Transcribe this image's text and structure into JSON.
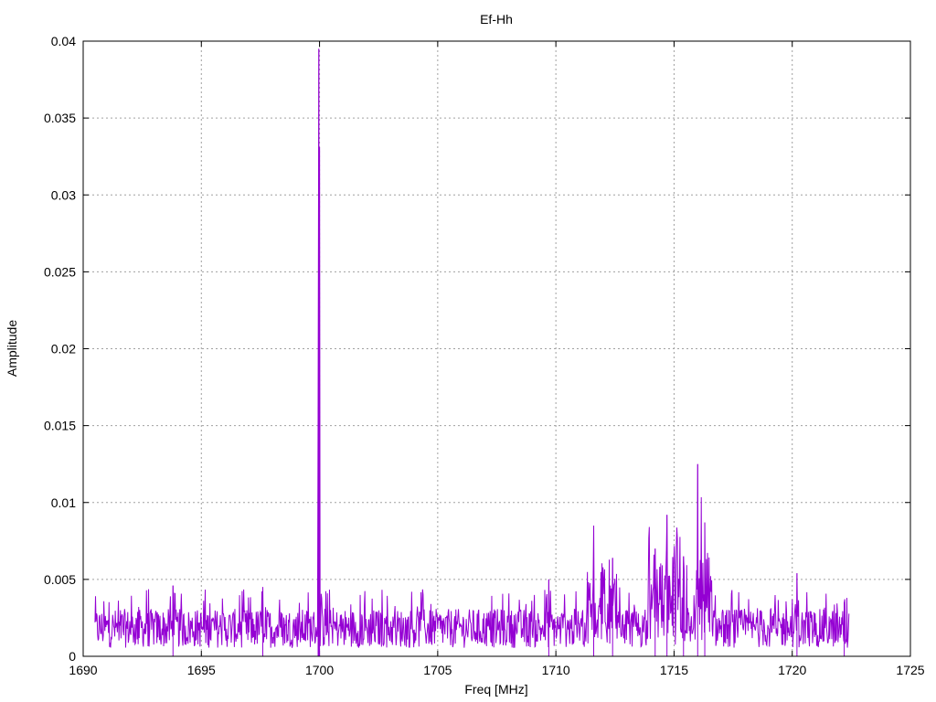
{
  "chart_data": {
    "type": "line",
    "title": "Ef-Hh",
    "xlabel": "Freq [MHz]",
    "ylabel": "Amplitude",
    "xlim": [
      1690,
      1725
    ],
    "ylim": [
      0,
      0.04
    ],
    "xticks": [
      1690,
      1695,
      1700,
      1705,
      1710,
      1715,
      1720,
      1725
    ],
    "yticks": [
      0,
      0.005,
      0.01,
      0.015,
      0.02,
      0.025,
      0.03,
      0.035,
      0.04
    ],
    "ytick_labels": [
      "0",
      "0.005",
      "0.01",
      "0.015",
      "0.02",
      "0.025",
      "0.03",
      "0.035",
      "0.04"
    ],
    "grid": true,
    "legend": "none",
    "series": [
      {
        "color": "#9400d3",
        "x_range": [
          1690.5,
          1722.4
        ],
        "peaks": [
          {
            "x": 1693.8,
            "y": 0.0046
          },
          {
            "x": 1697.6,
            "y": 0.0045
          },
          {
            "x": 1699.97,
            "y": 0.0395
          },
          {
            "x": 1700.0,
            "y": 0.0331
          },
          {
            "x": 1699.94,
            "y": 0.0162
          },
          {
            "x": 1709.7,
            "y": 0.005
          },
          {
            "x": 1711.6,
            "y": 0.0085
          },
          {
            "x": 1712.4,
            "y": 0.0064
          },
          {
            "x": 1714.2,
            "y": 0.007
          },
          {
            "x": 1714.7,
            "y": 0.0092
          },
          {
            "x": 1715.4,
            "y": 0.0065
          },
          {
            "x": 1716.0,
            "y": 0.0125
          },
          {
            "x": 1716.3,
            "y": 0.0087
          },
          {
            "x": 1720.2,
            "y": 0.0054
          },
          {
            "x": 1722.2,
            "y": 0.0035
          }
        ],
        "noise_floor": 0.0022
      }
    ]
  }
}
